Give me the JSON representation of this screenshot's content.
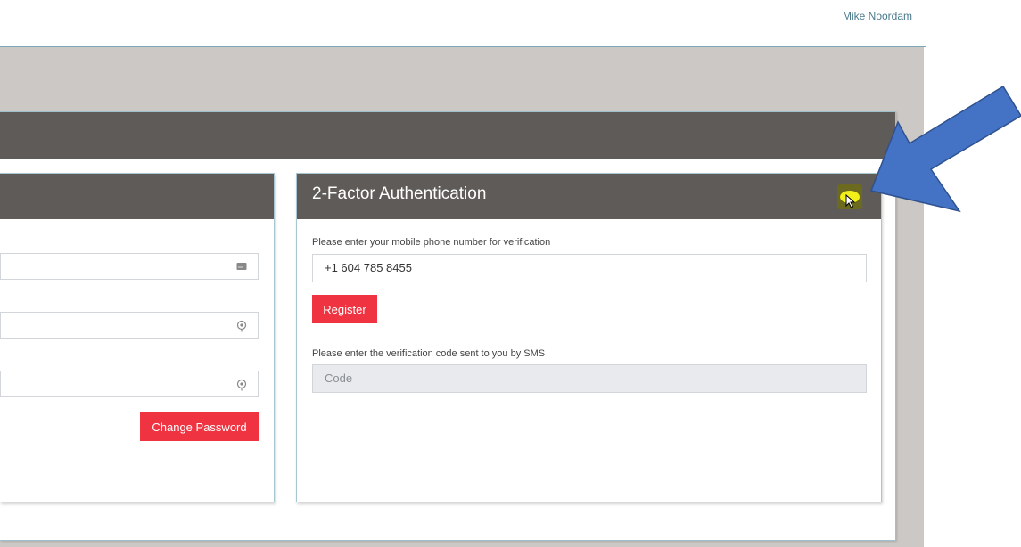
{
  "header": {
    "user_name": "Mike Noordam"
  },
  "password_card": {
    "change_password_label": "Change Password",
    "fields": [
      {
        "icon": "card-icon",
        "value": ""
      },
      {
        "icon": "eye-icon",
        "value": ""
      },
      {
        "icon": "eye-icon",
        "value": ""
      }
    ]
  },
  "two_factor": {
    "title": "2-Factor Authentication",
    "phone_label": "Please enter your mobile phone number for verification",
    "phone_value": "+1 604 785 8455",
    "register_label": "Register",
    "code_label": "Please enter the verification code sent to you by SMS",
    "code_placeholder": "Code"
  },
  "colors": {
    "panel_header": "#5f5b58",
    "accent_red": "#ef3340",
    "background_gray": "#ccc8c6",
    "toggle_yellow": "#f2f01a",
    "annotation_arrow": "#4472c4"
  }
}
